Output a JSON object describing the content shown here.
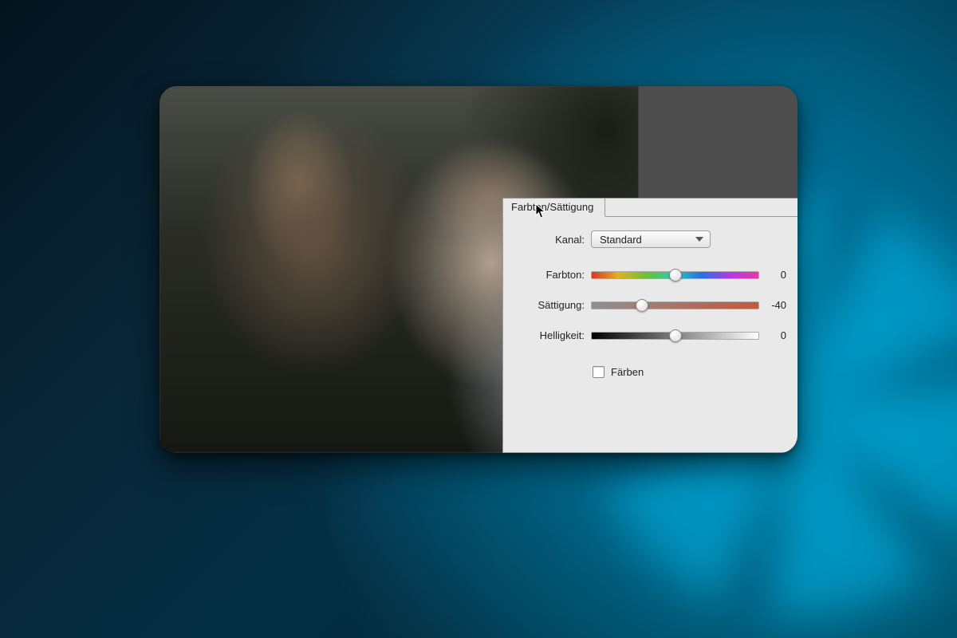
{
  "panel": {
    "tab_label": "Farbton/Sättigung",
    "channel_label": "Kanal:",
    "channel_value": "Standard",
    "sliders": {
      "hue": {
        "label": "Farbton:",
        "value": "0",
        "pos_pct": 50
      },
      "saturation": {
        "label": "Sättigung:",
        "value": "-40",
        "pos_pct": 30
      },
      "lightness": {
        "label": "Helligkeit:",
        "value": "0",
        "pos_pct": 50
      }
    },
    "colorize_label": "Färben",
    "colorize_checked": false
  }
}
